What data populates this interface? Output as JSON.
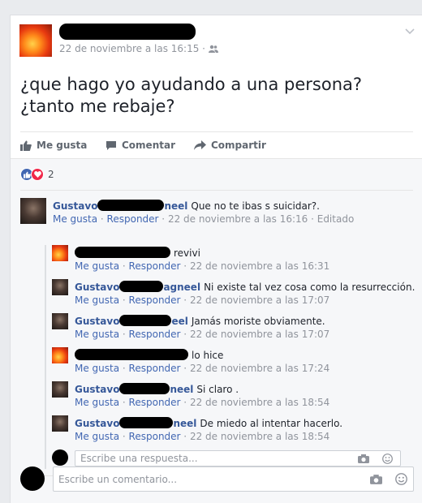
{
  "post": {
    "author_name_suffix": "",
    "timestamp": "22 de noviembre a las 16:15",
    "separator": "·",
    "audience_icon": "friends-icon",
    "text_line1": "¿que hago yo ayudando a una persona?",
    "text_line2": "¿tanto me rebaje?",
    "menu_icon": "chevron-down-icon"
  },
  "actions": {
    "like": "Me gusta",
    "comment": "Comentar",
    "share": "Compartir"
  },
  "reactions": {
    "count": "2",
    "like_color": "#4267b2",
    "love_color": "#f0284a"
  },
  "comments": [
    {
      "name_start": "Gustavo",
      "name_end": "neel",
      "text": "Que no te ibas s suicidar?.",
      "like": "Me gusta",
      "reply": "Responder",
      "time": "22 de noviembre a las 16:16",
      "edited": "Editado",
      "avatar": "dark"
    }
  ],
  "replies": [
    {
      "name_start": "",
      "name_end": "",
      "text": "revivi",
      "like": "Me gusta",
      "reply": "Responder",
      "time": "22 de noviembre a las 16:31",
      "avatar": "flame"
    },
    {
      "name_start": "Gustavo",
      "name_end": "agneel",
      "text": "Ni existe tal vez cosa como la resurrección.",
      "like": "Me gusta",
      "reply": "Responder",
      "time": "22 de noviembre a las 17:07",
      "avatar": "dark"
    },
    {
      "name_start": "Gustavo",
      "name_end": "eel",
      "text": "Jamás moriste obviamente.",
      "like": "Me gusta",
      "reply": "Responder",
      "time": "22 de noviembre a las 17:07",
      "avatar": "dark"
    },
    {
      "name_start": "",
      "name_end": "",
      "text": "lo hice",
      "like": "Me gusta",
      "reply": "Responder",
      "time": "22 de noviembre a las 17:24",
      "avatar": "flame"
    },
    {
      "name_start": "Gustavo",
      "name_end": "neel",
      "text": "Si claro .",
      "like": "Me gusta",
      "reply": "Responder",
      "time": "22 de noviembre a las 18:54",
      "avatar": "dark"
    },
    {
      "name_start": "Gustavo",
      "name_end": "neel",
      "text": "De miedo al intentar hacerlo.",
      "like": "Me gusta",
      "reply": "Responder",
      "time": "22 de noviembre a las 18:54",
      "avatar": "dark"
    }
  ],
  "reply_input": {
    "placeholder": "Escribe una respuesta...",
    "camera_icon": "camera-icon",
    "emoji_icon": "emoji-icon"
  },
  "comment_input": {
    "placeholder": "Escribe un comentario...",
    "camera_icon": "camera-icon",
    "emoji_icon": "emoji-icon"
  }
}
